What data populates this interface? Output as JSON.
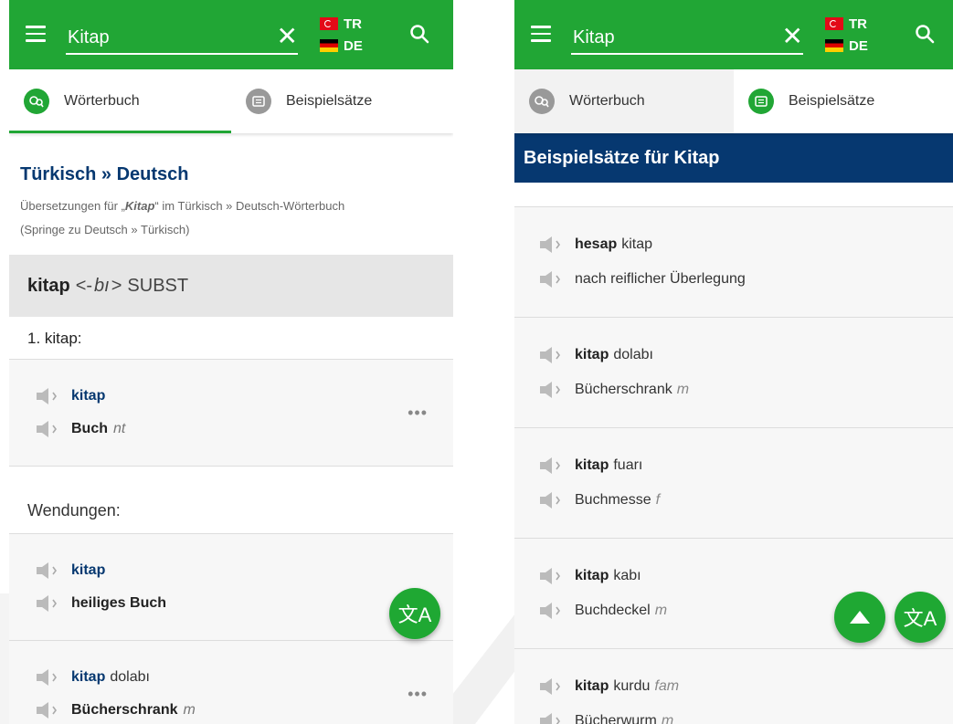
{
  "left": {
    "search": {
      "value": "Kitap"
    },
    "langs": {
      "source": "TR",
      "target": "DE"
    },
    "tabs": [
      {
        "label": "Wörterbuch"
      },
      {
        "label": "Beispielsätze"
      }
    ],
    "dictionary": {
      "title": "Türkisch » Deutsch",
      "subtitle_prefix": "Übersetzungen für „",
      "subtitle_word": "Kitap",
      "subtitle_suffix": "“ im Türkisch » Deutsch-Wörterbuch",
      "subtitle_link": "(Springe zu Deutsch » Türkisch)",
      "headword": "kitap",
      "grammar_pre": "<-",
      "grammar_form": "bı",
      "grammar_post": ">",
      "pos": "SUBST",
      "meaning_label": "1. kitap:",
      "entries": [
        {
          "source": "kitap",
          "target": "Buch",
          "gender": "nt"
        }
      ],
      "phrases_label": "Wendungen:",
      "phrases": [
        {
          "source": "kitap",
          "target": "heiliges Buch"
        },
        {
          "source": "kitap",
          "source_rest": "dolabı",
          "target": "Bücherschrank",
          "gender": "m"
        }
      ],
      "more_label": "•••"
    },
    "fab_translate_label": "文A"
  },
  "right": {
    "search": {
      "value": "Kitap"
    },
    "langs": {
      "source": "TR",
      "target": "DE"
    },
    "tabs": [
      {
        "label": "Wörterbuch"
      },
      {
        "label": "Beispielsätze"
      }
    ],
    "banner": "Beispielsätze für Kitap",
    "examples": [
      {
        "src_bold": "hesap",
        "src_rest": "kitap",
        "tgt": "nach reiflicher Überlegung",
        "gender": ""
      },
      {
        "src_bold": "kitap",
        "src_rest": "dolabı",
        "tgt": "Bücherschrank",
        "gender": "m"
      },
      {
        "src_bold": "kitap",
        "src_rest": "fuarı",
        "tgt": "Buchmesse",
        "gender": "f"
      },
      {
        "src_bold": "kitap",
        "src_rest": "kabı",
        "tgt": "Buchdeckel",
        "gender": "m"
      },
      {
        "src_bold": "kitap",
        "src_rest": "kurdu",
        "src_note": "fam",
        "tgt": "Bücherwurm",
        "gender": "m"
      }
    ],
    "fab_translate_label": "文A"
  },
  "colors": {
    "brand_green": "#21a635",
    "navy": "#063870",
    "shade": "#e6e6e6"
  },
  "icons": [
    "menu-icon",
    "clear-icon",
    "search-icon",
    "flag-tr-icon",
    "flag-de-icon",
    "dictionary-icon",
    "example-sentences-icon",
    "speaker-icon",
    "more-options-icon",
    "translate-icon",
    "scroll-up-icon"
  ]
}
